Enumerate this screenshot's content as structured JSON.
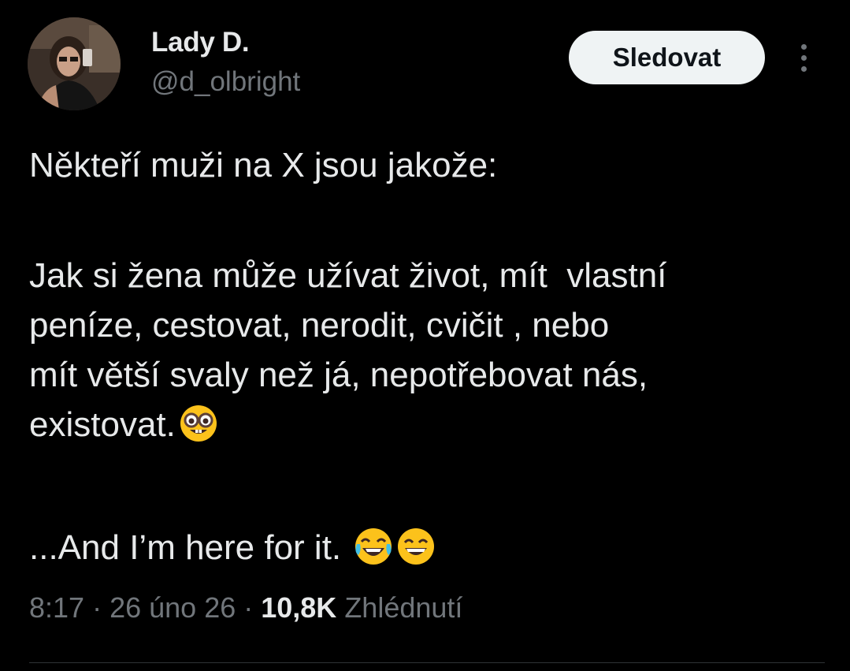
{
  "author": {
    "display_name": "Lady D.",
    "handle": "@d_olbright"
  },
  "actions": {
    "follow_label": "Sledovat",
    "more_icon": "more-vertical-icon"
  },
  "tweet": {
    "line1": "Někteří muži na X jsou jakože:",
    "para2_lines": [
      "Jak si žena může užívat život, mít  vlastní",
      "peníze, cestovat, nerodit, cvičit , nebo",
      "mít větší svaly než já, nepotřebovat nás,",
      "existovat."
    ],
    "para2_emoji": "nerd-face-emoji",
    "line3": "...And I’m here for it. ",
    "line3_emojis": [
      "laughing-tears-emoji",
      "grinning-face-emoji"
    ]
  },
  "meta": {
    "time": "8:17",
    "separator": " · ",
    "date": "26 úno 26",
    "views_count": "10,8K",
    "views_label": " Zhlédnutí"
  },
  "colors": {
    "background": "#000000",
    "text_primary": "#e7e9ea",
    "text_secondary": "#71767b",
    "button_bg": "#eff3f4",
    "button_text": "#0f1419",
    "divider": "#2f3336"
  }
}
